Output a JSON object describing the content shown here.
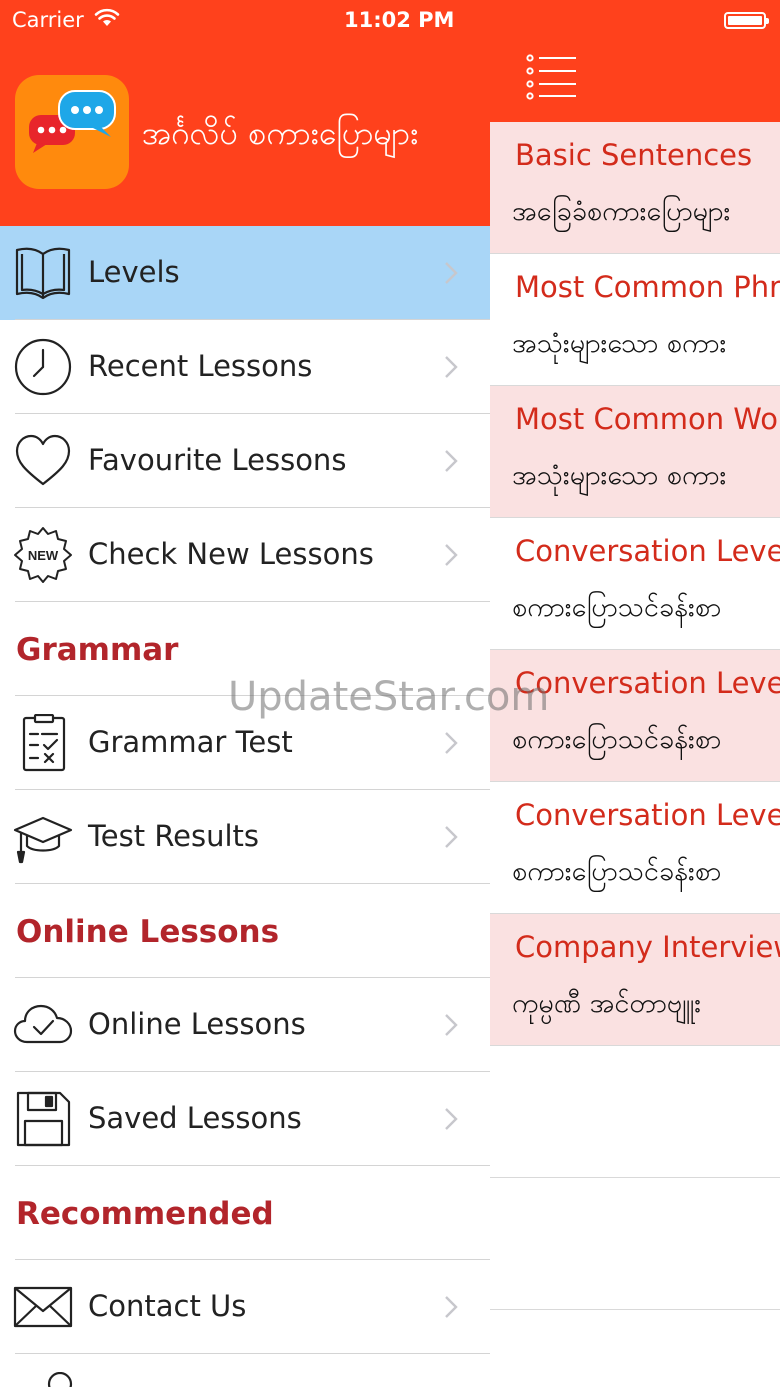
{
  "status_bar": {
    "carrier": "Carrier",
    "time": "11:02 PM"
  },
  "app": {
    "title": "အင်္ဂလိပ် စကားပြောများ",
    "logo_text": "အင်္ဂလိပ်\nစကားပြောများ"
  },
  "drawer": {
    "items": [
      {
        "label": "Levels",
        "icon": "book-icon",
        "active": true
      },
      {
        "label": "Recent Lessons",
        "icon": "clock-icon"
      },
      {
        "label": "Favourite Lessons",
        "icon": "heart-icon"
      },
      {
        "label": "Check New Lessons",
        "icon": "new-badge-icon",
        "badge_text": "NEW"
      }
    ],
    "grammar": {
      "title": "Grammar",
      "items": [
        {
          "label": "Grammar Test",
          "icon": "clipboard-check-icon"
        },
        {
          "label": "Test Results",
          "icon": "graduation-cap-icon"
        }
      ]
    },
    "online": {
      "title": "Online Lessons",
      "items": [
        {
          "label": "Online Lessons",
          "icon": "cloud-check-icon"
        },
        {
          "label": "Saved Lessons",
          "icon": "floppy-disk-icon"
        }
      ]
    },
    "recommended": {
      "title": "Recommended",
      "items": [
        {
          "label": "Contact Us",
          "icon": "envelope-icon"
        }
      ]
    }
  },
  "lessons": [
    {
      "title": "Basic Sentences",
      "subtitle": "အခြေခံစကားပြောများ"
    },
    {
      "title": "Most Common Phr",
      "subtitle": "အသုံးများသော စကား"
    },
    {
      "title": "Most Common Wo",
      "subtitle": "အသုံးများသော စကား"
    },
    {
      "title": "Conversation Leve",
      "subtitle": "စကားပြောသင်ခန်းစာ"
    },
    {
      "title": "Conversation Leve",
      "subtitle": "စကားပြောသင်ခန်းစာ"
    },
    {
      "title": "Conversation Leve",
      "subtitle": "စကားပြောသင်ခန်းစာ"
    },
    {
      "title": "Company Interview",
      "subtitle": "ကုမ္ပဏီ အင်တာဗျူး"
    }
  ],
  "watermark": "UpdateStar.com",
  "colors": {
    "header": "#ff411c",
    "active_row": "#a9d6f7",
    "section_title": "#b2252b",
    "lesson_title": "#d32b1b",
    "lesson_tint": "#fae1e1",
    "logo_bg": "#ff8a0d"
  }
}
